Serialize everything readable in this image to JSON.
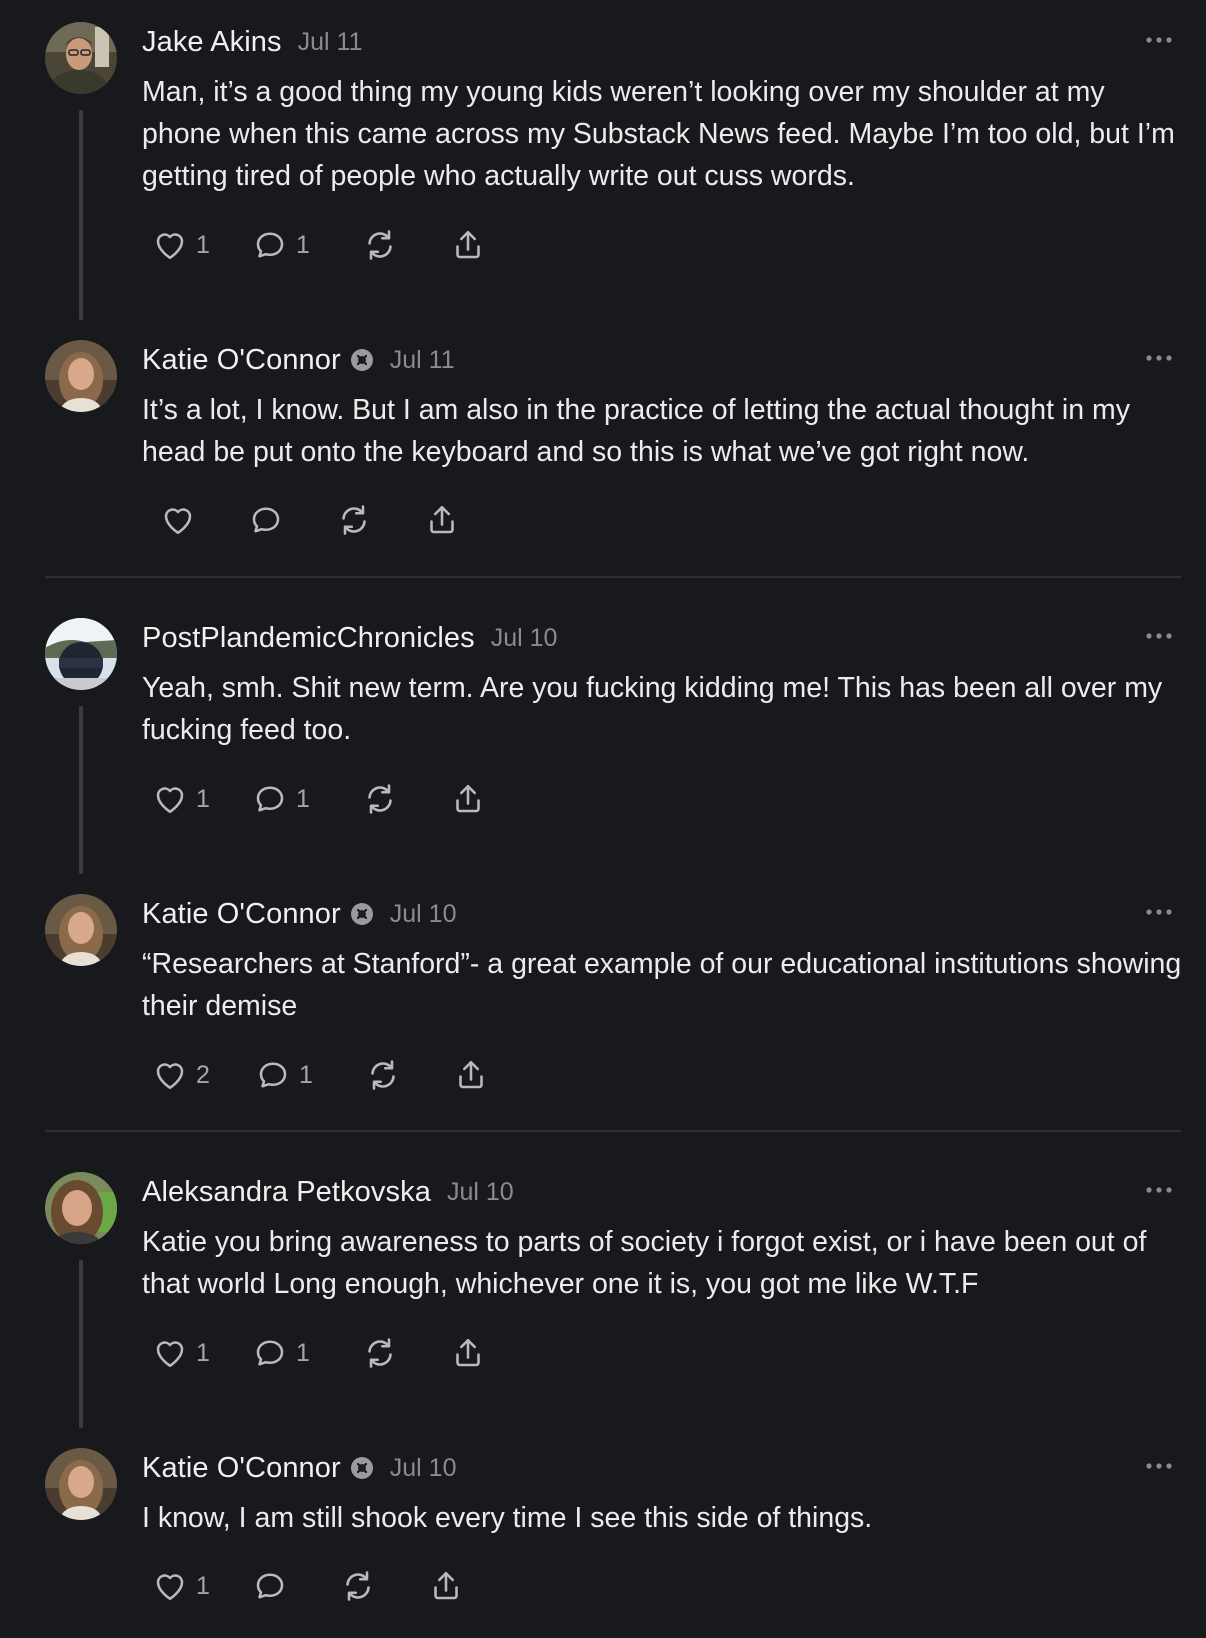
{
  "colors": {
    "background": "#18191c",
    "text": "#ececec",
    "muted": "#8a8b8f",
    "thread_line": "#3c3d41"
  },
  "comments": [
    {
      "author": "Jake Akins",
      "date": "Jul 11",
      "verified": false,
      "text": "Man, it’s a good thing my young kids weren’t looking over my shoulder at my phone when this came across my Substack News feed. Maybe I’m too old, but I’m getting tired of people who actually write out cuss words.",
      "likes": "1",
      "replies": "1"
    },
    {
      "author": "Katie O'Connor",
      "date": "Jul 11",
      "verified": true,
      "text": "It’s a lot, I know. But I am also in the practice of letting the actual thought in my head be put onto the keyboard and so this is what we’ve got right now.",
      "likes": "",
      "replies": ""
    },
    {
      "author": "PostPlandemicChronicles",
      "date": "Jul 10",
      "verified": false,
      "text": "Yeah, smh. Shit new term. Are you fucking kidding me! This has been all over my fucking feed too.",
      "likes": "1",
      "replies": "1"
    },
    {
      "author": "Katie O'Connor",
      "date": "Jul 10",
      "verified": true,
      "text": "“Researchers at Stanford”- a great example of our educational institutions showing their demise",
      "likes": "2",
      "replies": "1"
    },
    {
      "author": "Aleksandra Petkovska",
      "date": "Jul 10",
      "verified": false,
      "text": "Katie you bring awareness to parts of society i forgot exist, or i have been out of that world Long enough, whichever one it is, you got me like W.T.F",
      "likes": "1",
      "replies": "1"
    },
    {
      "author": "Katie O'Connor",
      "date": "Jul 10",
      "verified": true,
      "text": "I know, I am still shook every time I see this side of things.",
      "likes": "1",
      "replies": ""
    }
  ]
}
